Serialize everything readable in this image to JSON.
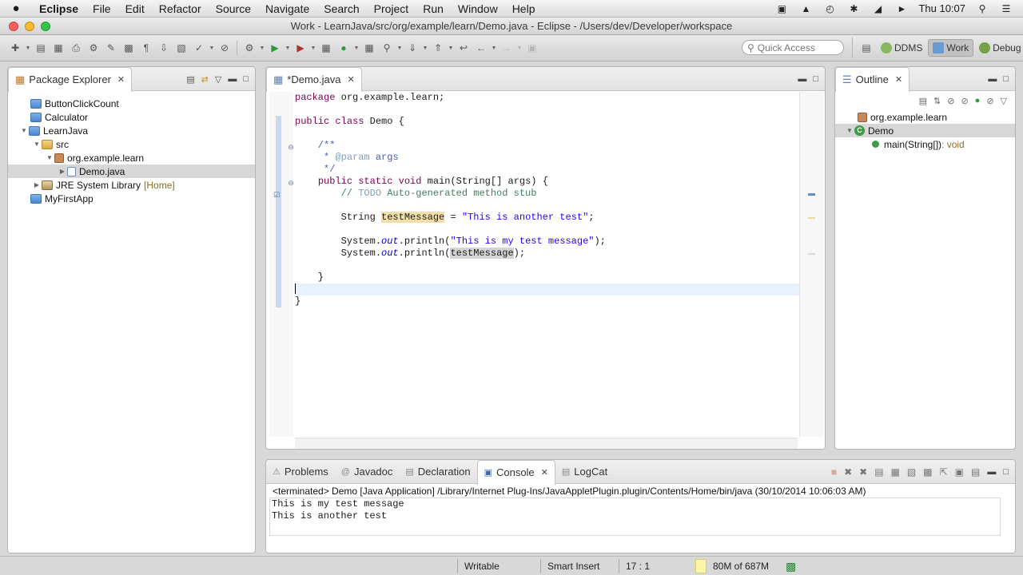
{
  "menubar": {
    "apple": "",
    "items": [
      "Eclipse",
      "File",
      "Edit",
      "Refactor",
      "Source",
      "Navigate",
      "Search",
      "Project",
      "Run",
      "Window",
      "Help"
    ],
    "clock": "Thu 10:07"
  },
  "window": {
    "title": "Work - LearnJava/src/org/example/learn/Demo.java - Eclipse - /Users/dev/Developer/workspace"
  },
  "toolbar": {
    "quick_access_placeholder": "Quick Access",
    "perspectives": [
      {
        "label": "DDMS",
        "active": false
      },
      {
        "label": "Work",
        "active": true
      },
      {
        "label": "Debug",
        "active": false
      }
    ]
  },
  "package_explorer": {
    "tab_label": "Package Explorer",
    "items": [
      {
        "label": "ButtonClickCount",
        "depth": 0,
        "icon": "project-folder-icon"
      },
      {
        "label": "Calculator",
        "depth": 0,
        "icon": "project-folder-icon"
      },
      {
        "label": "LearnJava",
        "depth": 0,
        "icon": "project-folder-icon",
        "expanded": true
      },
      {
        "label": "src",
        "depth": 1,
        "icon": "source-folder-icon",
        "expanded": true
      },
      {
        "label": "org.example.learn",
        "depth": 2,
        "icon": "package-icon",
        "expanded": true
      },
      {
        "label": "Demo.java",
        "depth": 3,
        "icon": "java-file-icon",
        "selected": true
      },
      {
        "label": "JRE System Library",
        "suffix": "[Home]",
        "depth": 1,
        "icon": "library-icon"
      },
      {
        "label": "MyFirstApp",
        "depth": 0,
        "icon": "project-folder-icon"
      }
    ]
  },
  "editor": {
    "tab_label": "*Demo.java",
    "lines": {
      "l1_kw": "package",
      "l1_rest": " org.example.learn;",
      "l2_kw1": "public",
      "l2_kw2": "class",
      "l2_rest": " Demo {",
      "l3": "    /**",
      "l4_star": "     * ",
      "l4_tag": "@param",
      "l4_rest": " args",
      "l5": "     */",
      "l6_kw1": "public",
      "l6_kw2": "static",
      "l6_kw3": "void",
      "l6_rest": " main(String[] args) {",
      "l7_pre": "        // ",
      "l7_todo": "TODO",
      "l7_rest": " Auto-generated method stub",
      "l8_type": "        String ",
      "l8_var": "testMessage",
      "l8_eq": " = ",
      "l8_str": "\"This is another test\"",
      "l8_end": ";",
      "l9_a": "        System.",
      "l9_out": "out",
      "l9_b": ".println(",
      "l9_str": "\"This is my test message\"",
      "l9_end": ");",
      "l10_a": "        System.",
      "l10_out": "out",
      "l10_b": ".println(",
      "l10_var": "testMessage",
      "l10_end": ");",
      "l11": "    }",
      "l12": "}"
    }
  },
  "outline": {
    "tab_label": "Outline",
    "items": [
      {
        "label": "org.example.learn",
        "icon": "package-icon"
      },
      {
        "label": "Demo",
        "icon": "class-icon",
        "selected": true
      },
      {
        "label": "main(String[])",
        "type": " : void",
        "icon": "method-icon"
      }
    ]
  },
  "bottom_panel": {
    "tabs": [
      "Problems",
      "Javadoc",
      "Declaration",
      "Console",
      "LogCat"
    ],
    "active_tab": "Console",
    "console_label": "<terminated> Demo [Java Application] /Library/Internet Plug-Ins/JavaAppletPlugin.plugin/Contents/Home/bin/java (30/10/2014 10:06:03 AM)",
    "output": [
      "This is my test message",
      "This is another test"
    ]
  },
  "statusbar": {
    "writable": "Writable",
    "insert_mode": "Smart Insert",
    "position": "17 : 1",
    "heap": "80M of 687M"
  },
  "colors": {
    "keyword": "#7f0055",
    "string": "#2a00ff",
    "comment": "#3f7f5f",
    "javadoc": "#3f5fbf",
    "current_line": "#e8f2fe",
    "selection": "#d7d7d7"
  }
}
